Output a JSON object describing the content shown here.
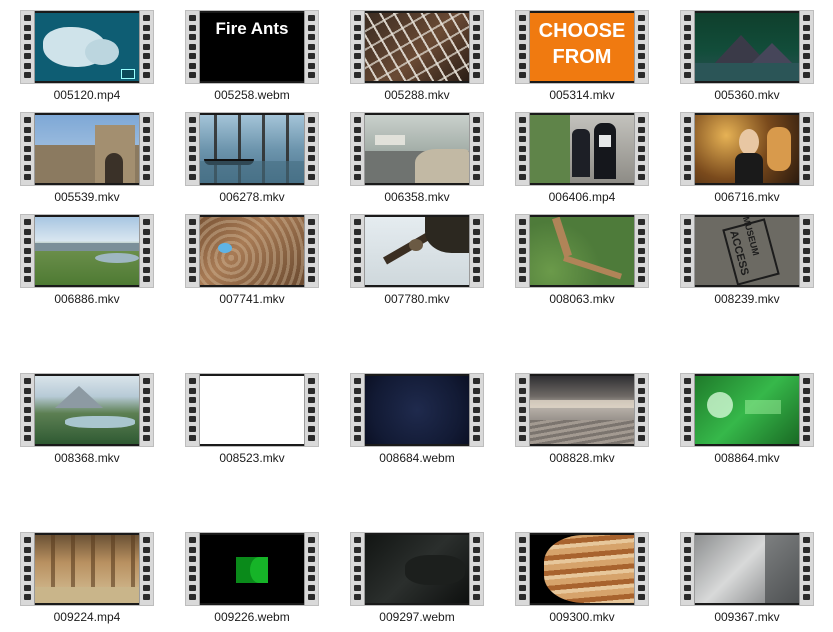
{
  "files": [
    {
      "name": "005120.mp4",
      "thumb": "map"
    },
    {
      "name": "005258.webm",
      "thumb": "fireants",
      "text": "Fire Ants"
    },
    {
      "name": "005288.mkv",
      "thumb": "cage"
    },
    {
      "name": "005314.mkv",
      "thumb": "choose",
      "text_line1": "CHOOSE",
      "text_line2": "FROM"
    },
    {
      "name": "005360.mkv",
      "thumb": "pyramids"
    },
    {
      "name": "005539.mkv",
      "thumb": "castle"
    },
    {
      "name": "006278.mkv",
      "thumb": "venice"
    },
    {
      "name": "006358.mkv",
      "thumb": "harbor"
    },
    {
      "name": "006406.mp4",
      "thumb": "police"
    },
    {
      "name": "006716.mkv",
      "thumb": "party"
    },
    {
      "name": "006886.mkv",
      "thumb": "meadow"
    },
    {
      "name": "007741.mkv",
      "thumb": "rocks"
    },
    {
      "name": "007780.mkv",
      "thumb": "branch"
    },
    {
      "name": "008063.mkv",
      "thumb": "path"
    },
    {
      "name": "008239.mkv",
      "thumb": "stamp",
      "stamp_line1": "MUSEUM",
      "stamp_line2": "ACCESS"
    },
    {
      "name": "008368.mkv",
      "thumb": "lake"
    },
    {
      "name": "008523.mkv",
      "thumb": "white"
    },
    {
      "name": "008684.webm",
      "thumb": "navy"
    },
    {
      "name": "008828.mkv",
      "thumb": "shore"
    },
    {
      "name": "008864.mkv",
      "thumb": "green"
    },
    {
      "name": "009224.mp4",
      "thumb": "hall"
    },
    {
      "name": "009226.webm",
      "thumb": "greenshape"
    },
    {
      "name": "009297.webm",
      "thumb": "dark"
    },
    {
      "name": "009300.mkv",
      "thumb": "jupiter"
    },
    {
      "name": "009367.mkv",
      "thumb": "fog"
    }
  ]
}
